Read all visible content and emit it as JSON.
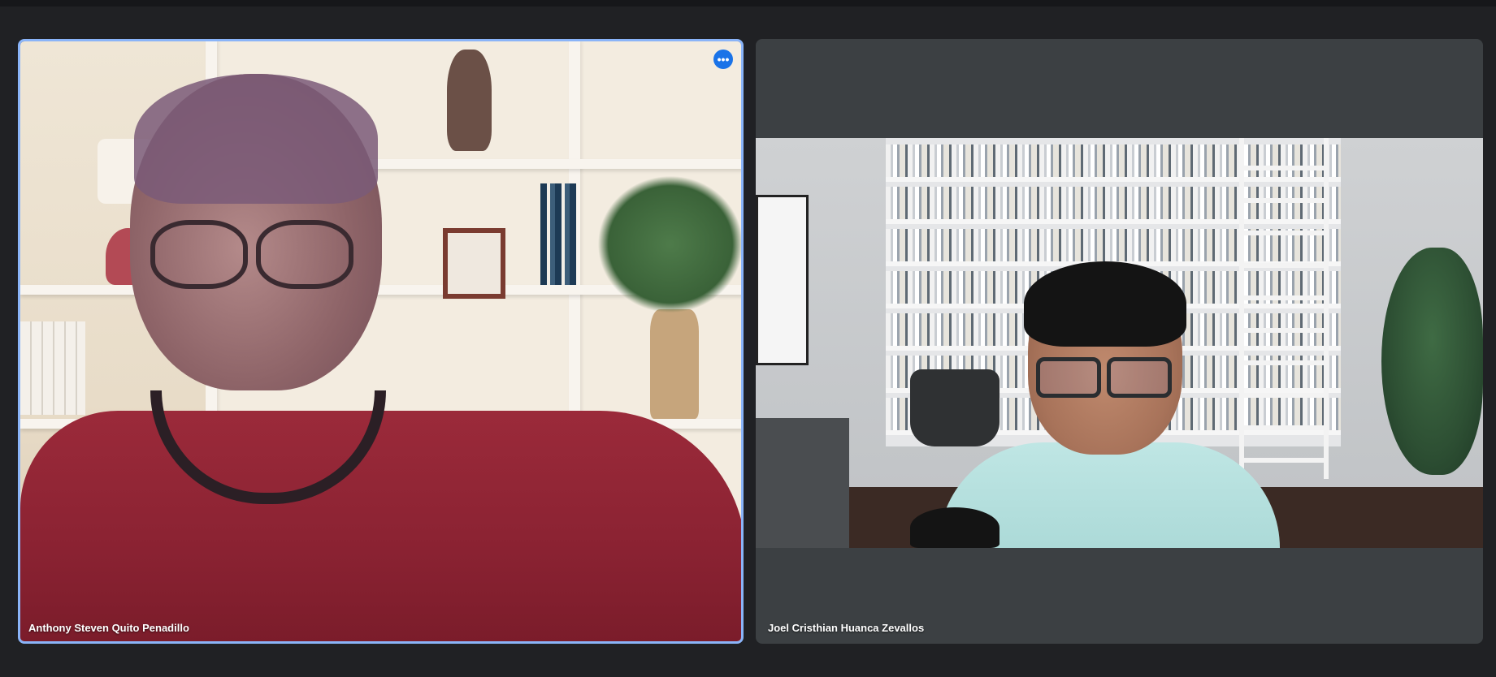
{
  "meeting": {
    "participants": [
      {
        "name": "Anthony Steven Quito Penadillo",
        "active_speaker": true,
        "more_options_icon": "more-horiz-icon"
      },
      {
        "name": "Joel Cristhian Huanca Zevallos",
        "active_speaker": false
      }
    ]
  },
  "colors": {
    "background": "#202124",
    "tile_background": "#3c4043",
    "active_speaker_border": "#8ab4f8",
    "more_button": "#1a73e8",
    "label_text": "#ffffff"
  }
}
